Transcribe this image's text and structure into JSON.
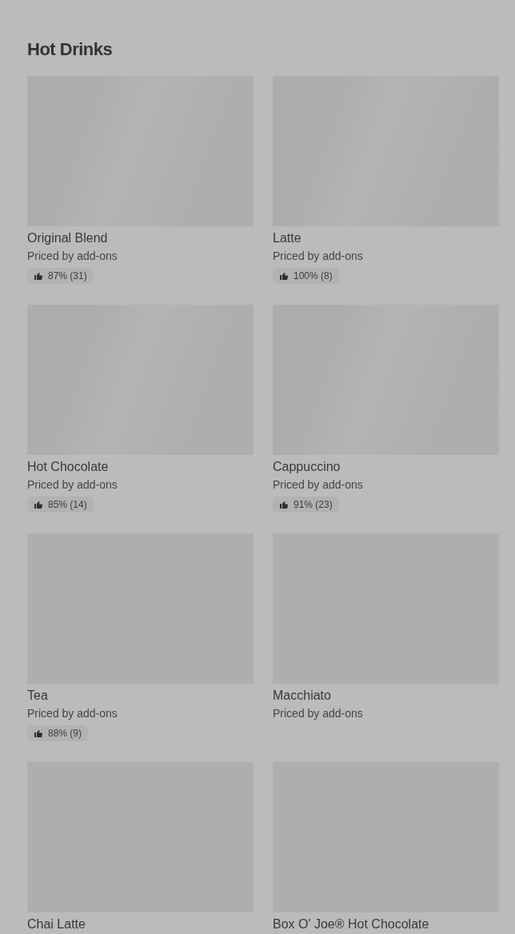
{
  "section": {
    "title": "Hot Drinks",
    "items": [
      {
        "name": "Original Blend",
        "price": "Priced by add-ons",
        "rating": "87% (31)"
      },
      {
        "name": "Latte",
        "price": "Priced by add-ons",
        "rating": "100% (8)"
      },
      {
        "name": "Hot Chocolate",
        "price": "Priced by add-ons",
        "rating": "85% (14)"
      },
      {
        "name": "Cappuccino",
        "price": "Priced by add-ons",
        "rating": "91% (23)"
      },
      {
        "name": "Tea",
        "price": "Priced by add-ons",
        "rating": "88% (9)"
      },
      {
        "name": "Macchiato",
        "price": "Priced by add-ons"
      },
      {
        "name": "Chai Latte"
      },
      {
        "name": "Box O' Joe® Hot Chocolate"
      }
    ]
  }
}
